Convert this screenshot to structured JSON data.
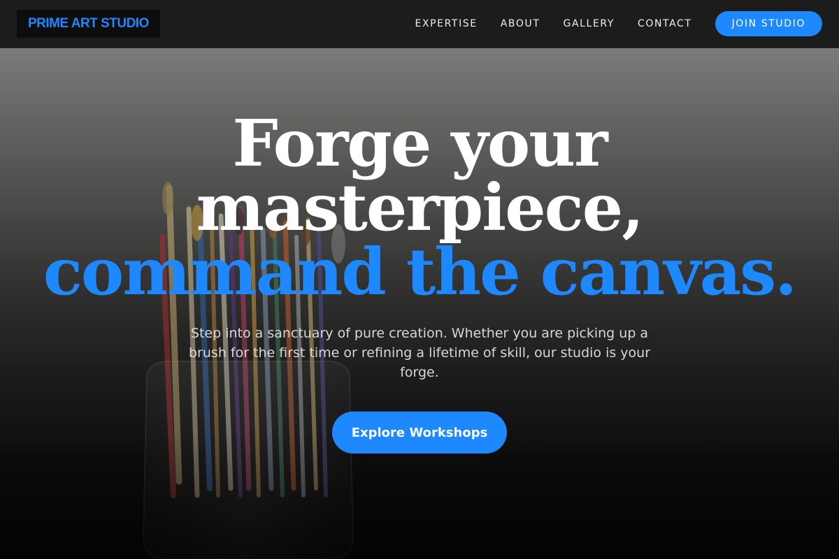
{
  "header": {
    "logo": "PRIME ART STUDIO",
    "nav": [
      {
        "label": "EXPERTISE"
      },
      {
        "label": "ABOUT"
      },
      {
        "label": "GALLERY"
      },
      {
        "label": "CONTACT"
      }
    ],
    "join_button": "JOIN STUDIO"
  },
  "hero": {
    "headline_line1": "Forge your",
    "headline_line2": "masterpiece,",
    "headline_accent": "command the canvas.",
    "subtext": "Step into a sanctuary of pure creation. Whether you are picking up a brush for the first time or refining a lifetime of skill, our studio is your forge.",
    "cta": "Explore Workshops",
    "background_icon": "paint-brushes-jar-image"
  },
  "colors": {
    "accent": "#1e88ff",
    "header_bg": "#1c1c1c",
    "logo_bg": "#0d0d0d"
  }
}
